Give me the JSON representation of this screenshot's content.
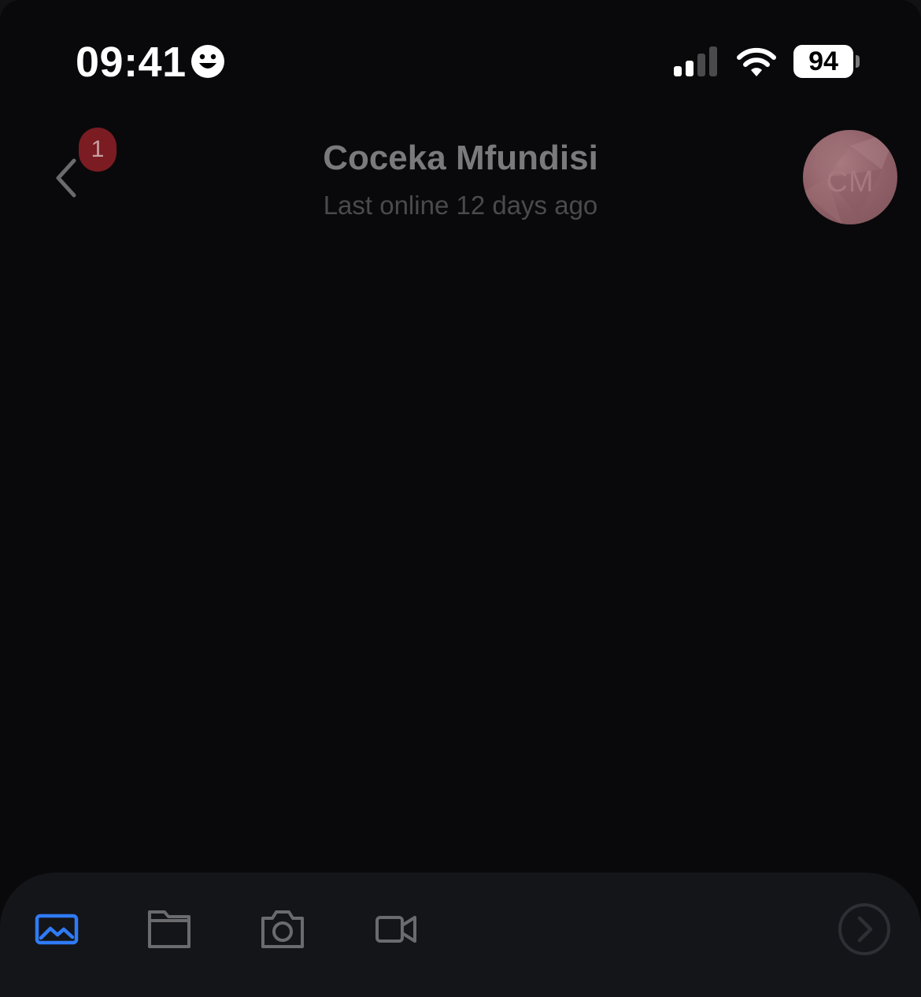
{
  "status_bar": {
    "time": "09:41",
    "battery_level": "94",
    "icons": [
      "smiley-icon",
      "signal-icon",
      "wifi-icon",
      "battery-icon"
    ]
  },
  "header": {
    "back_badge_count": "1",
    "contact_name": "Coceka Mfundisi",
    "contact_status": "Last online 12 days ago",
    "avatar_initials": "CM"
  },
  "toolbar": {
    "items": [
      "gallery-icon",
      "folder-icon",
      "camera-icon",
      "video-icon"
    ],
    "send_icon": "send-arrow-icon"
  },
  "colors": {
    "background": "#09090b",
    "toolbar": "#141519",
    "accent": "#2f7bf5",
    "badge": "#7a1c22",
    "muted_icon": "#6b6b6e"
  }
}
